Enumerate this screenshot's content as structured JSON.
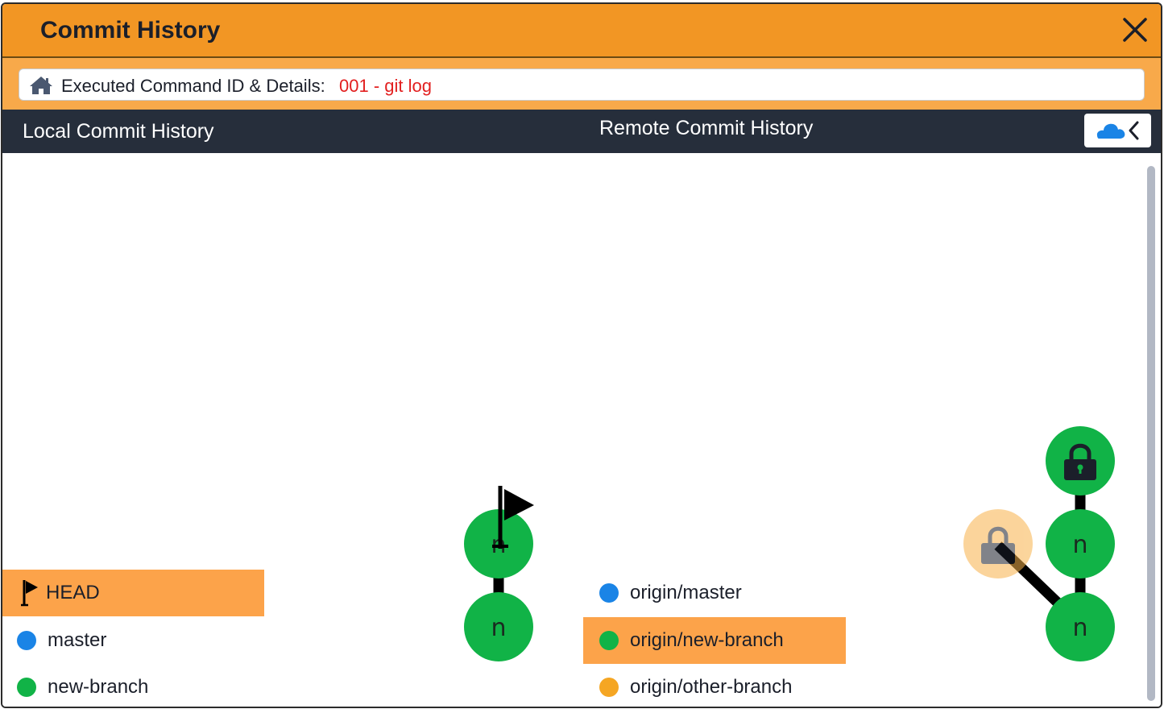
{
  "window": {
    "title": "Commit History"
  },
  "command": {
    "label": "Executed Command ID & Details:",
    "value": "001 - git log"
  },
  "panels": {
    "local_title": "Local Commit History",
    "remote_title": "Remote Commit History"
  },
  "local_legend": [
    {
      "label": "HEAD",
      "icon": "flag-icon",
      "active": true
    },
    {
      "label": "master",
      "color": "#1a84e6",
      "active": false
    },
    {
      "label": "new-branch",
      "color": "#11b347",
      "active": false
    }
  ],
  "remote_legend": [
    {
      "label": "origin/master",
      "color": "#1a84e6",
      "active": false
    },
    {
      "label": "origin/new-branch",
      "color": "#11b347",
      "active": true
    },
    {
      "label": "origin/other-branch",
      "color": "#f5a623",
      "active": false
    }
  ],
  "local_commits": [
    {
      "letter": "n",
      "head": true
    },
    {
      "letter": "n",
      "head": false
    }
  ],
  "remote_commits": [
    {
      "letter": "",
      "icon": "lock-icon"
    },
    {
      "letter": "n"
    },
    {
      "letter": "n"
    },
    {
      "letter": "",
      "icon": "lock-icon",
      "faded": true
    }
  ],
  "colors": {
    "accent": "#f29624",
    "accent_light": "#f8a94a",
    "dark_bar": "#262e3b",
    "commit_green": "#11b347",
    "highlight": "#fca34a",
    "command_text": "#e21f1f"
  }
}
